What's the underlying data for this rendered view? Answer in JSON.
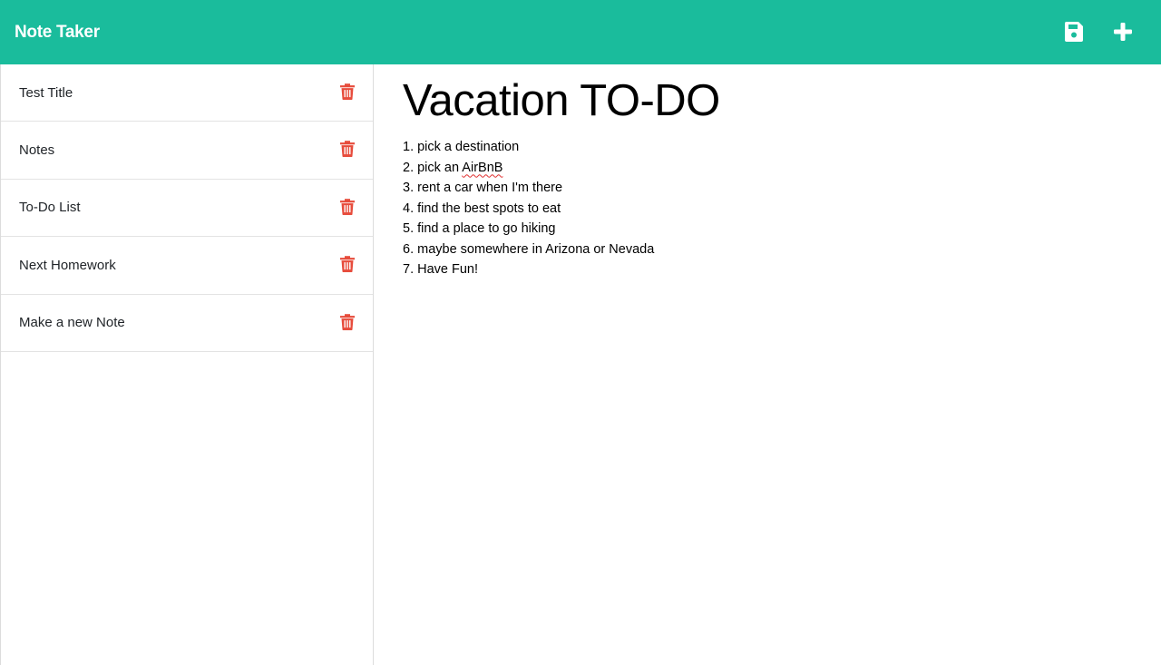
{
  "navbar": {
    "brand": "Note Taker",
    "save_icon": "save-icon",
    "new_icon": "plus-icon",
    "accent_color": "#1abc9c"
  },
  "sidebar": {
    "notes": [
      {
        "title": "Test Title",
        "icon": "trash-icon"
      },
      {
        "title": "Notes",
        "icon": "trash-icon"
      },
      {
        "title": "To-Do List",
        "icon": "trash-icon"
      },
      {
        "title": "Next Homework",
        "icon": "trash-icon"
      },
      {
        "title": "Make a new Note",
        "icon": "trash-icon"
      }
    ],
    "delete_color": "#e74c3c"
  },
  "editor": {
    "title": "Vacation TO-DO",
    "lines": [
      "1. pick a destination",
      "2. pick an ",
      "AirBnB",
      "3. rent a car when I'm there",
      "4. find the best spots to eat",
      "5. find a place to go hiking",
      "6. maybe somewhere in Arizona or Nevada",
      "7. Have Fun!"
    ]
  }
}
